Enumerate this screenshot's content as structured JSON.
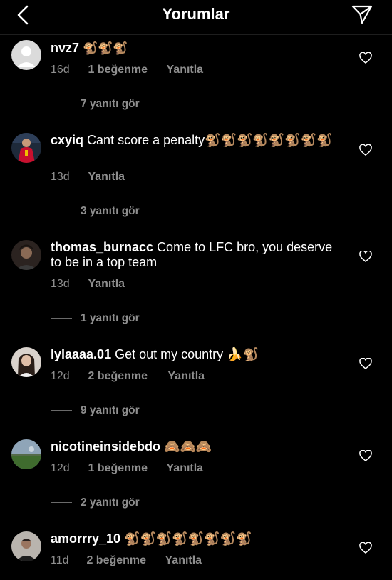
{
  "header": {
    "title": "Yorumlar",
    "back_icon": "chevron-left-icon",
    "send_icon": "paper-plane-icon"
  },
  "comments": [
    {
      "username": "nvz7",
      "text": "🐒🐒🐒",
      "time": "16d",
      "likes": "1 beğenme",
      "reply": "Yanıtla",
      "view_replies": "7 yanıtı gör"
    },
    {
      "username": "cxyiq",
      "text": "Cant score a penalty🐒🐒🐒🐒🐒🐒🐒🐒",
      "time": "13d",
      "likes": "",
      "reply": "Yanıtla",
      "view_replies": "3 yanıtı gör"
    },
    {
      "username": "thomas_burnacc",
      "text": "Come to LFC bro, you deserve to be in a top team",
      "time": "13d",
      "likes": "",
      "reply": "Yanıtla",
      "view_replies": "1 yanıtı gör"
    },
    {
      "username": "lylaaaa.01",
      "text": "Get out my country 🍌🐒",
      "time": "12d",
      "likes": "2 beğenme",
      "reply": "Yanıtla",
      "view_replies": "9 yanıtı gör"
    },
    {
      "username": "nicotineinsidebdo",
      "text": "🙈🙈🙈",
      "time": "12d",
      "likes": "1 beğenme",
      "reply": "Yanıtla",
      "view_replies": "2 yanıtı gör"
    },
    {
      "username": "amorrry_10",
      "text": "🐒🐒🐒🐒🐒🐒🐒🐒",
      "time": "11d",
      "likes": "2 beğenme",
      "reply": "Yanıtla",
      "view_replies": ""
    }
  ],
  "colors": {
    "background": "#000000",
    "secondary_text": "#8e8e8e"
  }
}
